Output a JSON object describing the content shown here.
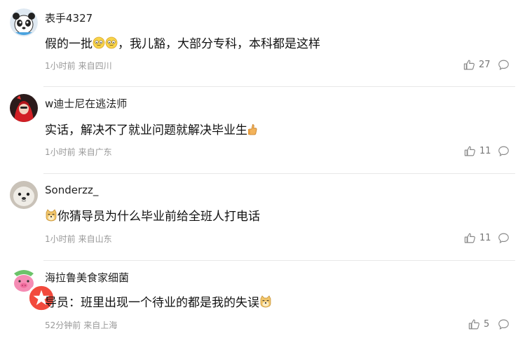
{
  "comments": [
    {
      "username": "表手4327",
      "text_1": "假的一批",
      "text_2": "，我儿豁，大部分专科，本科都是这样",
      "time": "1小时前",
      "location": "来自四川",
      "likes": "27",
      "icons": [
        "panda-avatar",
        "awkward-emoji",
        "awkward-emoji",
        "thumbs-up-outline-icon",
        "comment-bubble-icon"
      ]
    },
    {
      "username": "w迪士尼在逃法师",
      "text_1": "实话，解决不了就业问题就解决毕业生",
      "time": "1小时前",
      "location": "来自广东",
      "likes": "11",
      "icons": [
        "red-hood-avatar",
        "thumbs-up-emoji",
        "thumbs-up-outline-icon",
        "comment-bubble-icon"
      ]
    },
    {
      "username": "Sonderzz_",
      "text_1": "你猜导员为什么毕业前给全班人打电话",
      "time": "1小时前",
      "location": "来自山东",
      "likes": "11",
      "icons": [
        "seal-avatar",
        "doge-emoji",
        "thumbs-up-outline-icon",
        "comment-bubble-icon"
      ]
    },
    {
      "username": "海拉鲁美食家细菌",
      "text_1": "导员：班里出现一个待业的都是我的失误",
      "time": "52分钟前",
      "location": "来自上海",
      "likes": "5",
      "icons": [
        "pink-pig-avatar",
        "verified-badge",
        "doge-emoji",
        "thumbs-up-outline-icon",
        "comment-bubble-icon"
      ]
    }
  ]
}
